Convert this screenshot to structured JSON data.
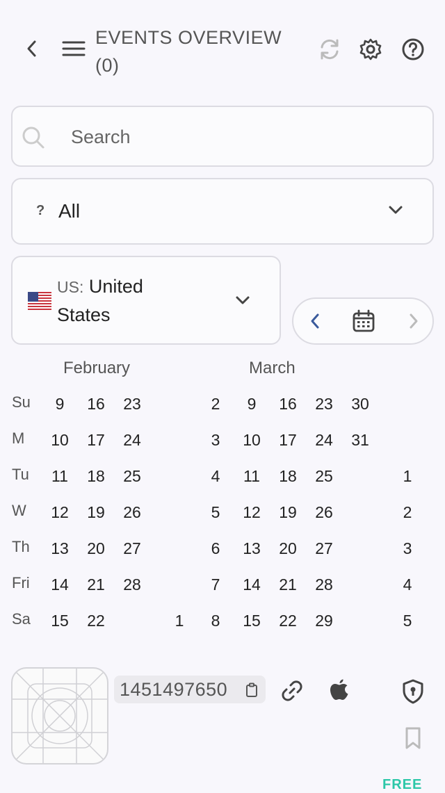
{
  "header": {
    "title_line1": "EVENTS OVERVIEW",
    "title_line2": "(0)"
  },
  "search": {
    "placeholder": "Search",
    "value": ""
  },
  "filter": {
    "icon_glyph": "?",
    "selected": "All"
  },
  "country": {
    "code": "US:",
    "name_line1": "United",
    "name_line2": "States"
  },
  "calendar": {
    "months": [
      "February",
      "March"
    ],
    "day_labels": [
      "Su",
      "M",
      "Tu",
      "W",
      "Th",
      "Fri",
      "Sa"
    ],
    "rows": [
      [
        "9",
        "16",
        "23",
        "",
        "2",
        "9",
        "16",
        "23",
        "30",
        ""
      ],
      [
        "10",
        "17",
        "24",
        "",
        "3",
        "10",
        "17",
        "24",
        "31",
        ""
      ],
      [
        "11",
        "18",
        "25",
        "",
        "4",
        "11",
        "18",
        "25",
        "",
        "1"
      ],
      [
        "12",
        "19",
        "26",
        "",
        "5",
        "12",
        "19",
        "26",
        "",
        "2"
      ],
      [
        "13",
        "20",
        "27",
        "",
        "6",
        "13",
        "20",
        "27",
        "",
        "3"
      ],
      [
        "14",
        "21",
        "28",
        "",
        "7",
        "14",
        "21",
        "28",
        "",
        "4"
      ],
      [
        "15",
        "22",
        "",
        "1",
        "8",
        "15",
        "22",
        "29",
        "",
        "5"
      ]
    ]
  },
  "app": {
    "id": "1451497650",
    "badge": "FREE"
  },
  "colors": {
    "accent": "#3a5a9c",
    "free": "#2cc7a8",
    "border": "#dcdbe2"
  }
}
